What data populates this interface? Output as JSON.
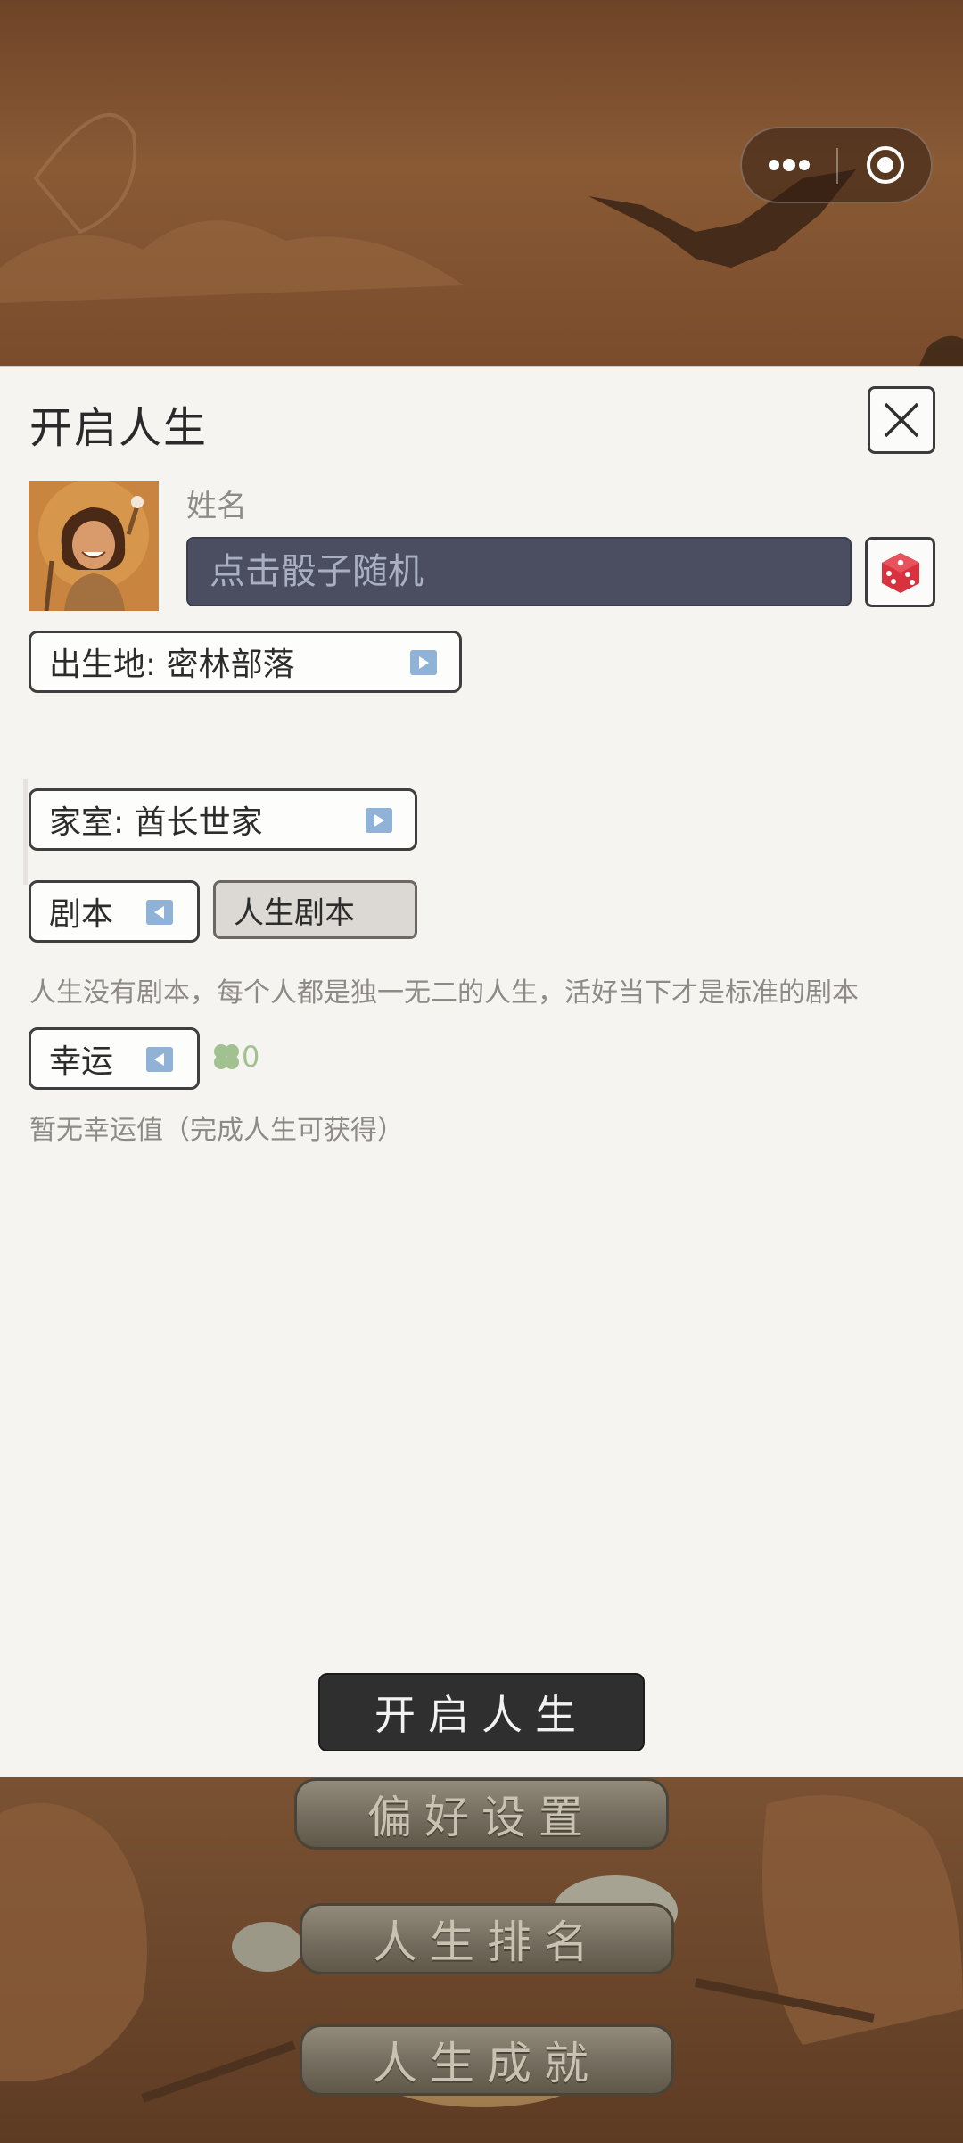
{
  "capsule": {
    "more_icon": "more-dots-icon",
    "close_icon": "target-circle-icon"
  },
  "panel": {
    "title": "开启人生",
    "close_icon": "close-x-icon",
    "name_label": "姓名",
    "name_placeholder": "点击骰子随机",
    "dice_icon": "dice-icon",
    "birthplace": "出生地: 密林部落",
    "family": "家室: 酋长世家",
    "script_label": "剧本",
    "script_value": "人生剧本",
    "script_desc": "人生没有剧本，每个人都是独一无二的人生，活好当下才是标准的剧本",
    "luck_label": "幸运",
    "luck_icon": "clover-icon",
    "luck_value": "0",
    "luck_desc": "暂无幸运值（完成人生可获得）",
    "start_button": "开启人生"
  },
  "menu": {
    "preferences": "偏好设置",
    "ranking": "人生排名",
    "achievements": "人生成就"
  },
  "colors": {
    "input_bg": "#4a4e60",
    "start_bg": "#2f2f2f",
    "arrow_blue": "#8fb2d6",
    "clover_green": "#a2c190"
  }
}
